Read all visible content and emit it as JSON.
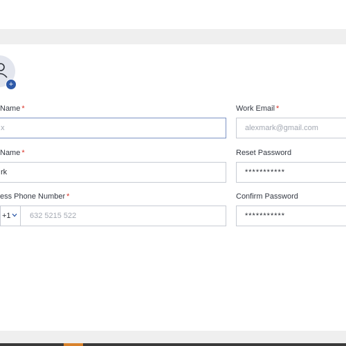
{
  "profile": {
    "avatar_add_symbol": "+"
  },
  "fields": {
    "first_name": {
      "label": "Name",
      "required": "*",
      "placeholder": "x"
    },
    "last_name": {
      "label": "Name",
      "required": "*",
      "value": "rk"
    },
    "phone": {
      "label": "ess Phone Number",
      "required": "*",
      "country_code": "+1",
      "placeholder": "632 5215 522"
    },
    "work_email": {
      "label": "Work Email",
      "required": "*",
      "placeholder": "alexmark@gmail.com"
    },
    "reset_password": {
      "label": "Reset Password",
      "value": "***********"
    },
    "confirm_password": {
      "label": "Confirm Password",
      "value": "***********"
    }
  },
  "colors": {
    "accent": "#2f5aa8",
    "required": "#d93025",
    "focus_border": "#7b93c4"
  },
  "icons": {
    "avatar": "user-icon",
    "add": "plus-icon",
    "country_dropdown": "chevron-down-icon"
  }
}
